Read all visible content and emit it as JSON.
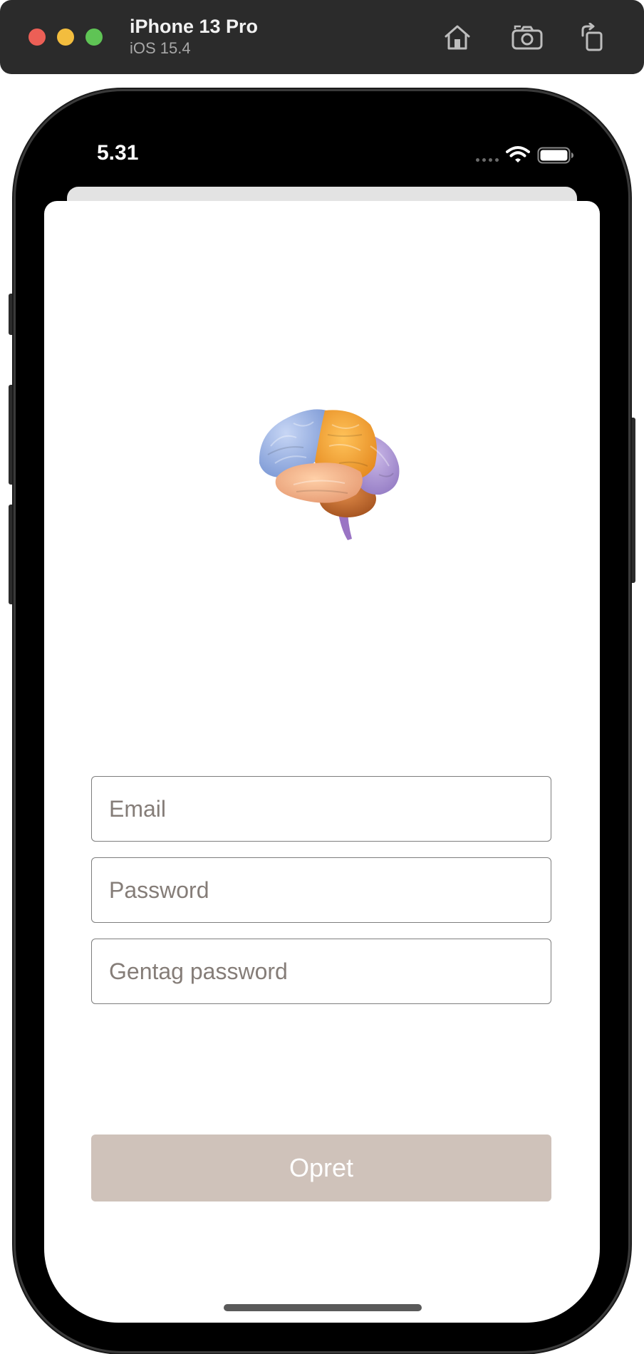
{
  "simulator": {
    "device_name": "iPhone 13 Pro",
    "os_version": "iOS 15.4",
    "buttons": [
      "home-icon",
      "screenshot-icon",
      "rotate-icon"
    ]
  },
  "status_bar": {
    "time": "5.31",
    "icons": [
      "signal-dots-icon",
      "wifi-icon",
      "battery-icon"
    ]
  },
  "signup": {
    "logo": "brain-icon",
    "email_placeholder": "Email",
    "password_placeholder": "Password",
    "repeat_password_placeholder": "Gentag password",
    "submit_label": "Opret"
  },
  "colors": {
    "submit_button": "#cfc2ba",
    "placeholder_text": "#857d78",
    "toolbar": "#2b2b2b"
  }
}
